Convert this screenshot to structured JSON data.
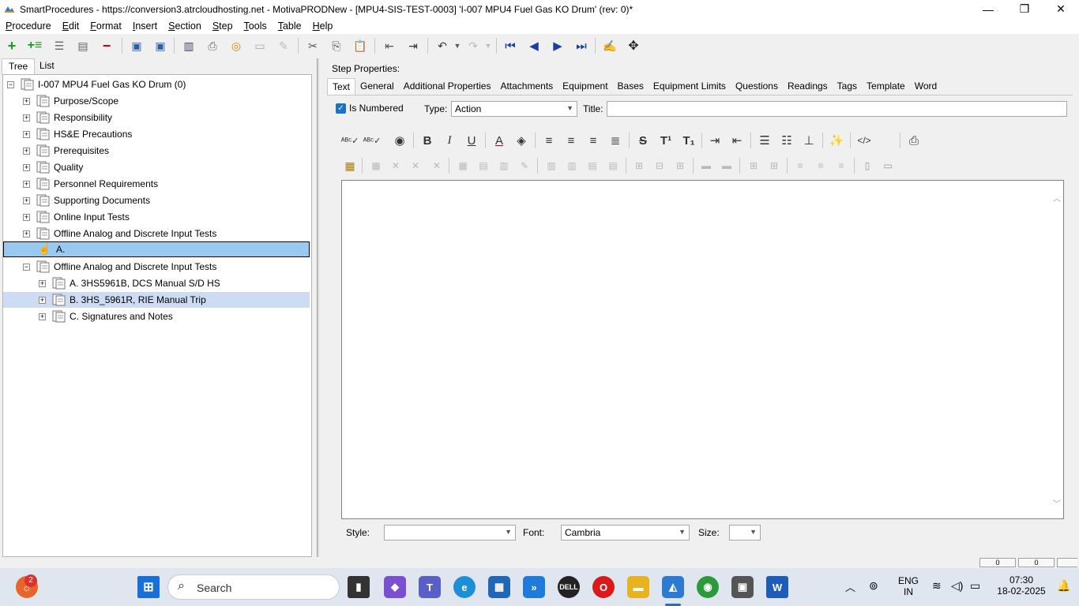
{
  "window": {
    "title": "SmartProcedures - https://conversion3.atrcloudhosting.net - MotivaPRODNew - [MPU4-SIS-TEST-0003] 'I-007 MPU4 Fuel Gas KO Drum' (rev: 0)*",
    "minimize": "—",
    "maximize": "❐",
    "close": "✕"
  },
  "menu": [
    {
      "key": "P",
      "rest": "rocedure"
    },
    {
      "key": "E",
      "rest": "dit"
    },
    {
      "key": "F",
      "rest": "ormat"
    },
    {
      "key": "I",
      "rest": "nsert"
    },
    {
      "key": "S",
      "rest": "ection"
    },
    {
      "key": "S",
      "rest": "tep"
    },
    {
      "key": "T",
      "rest": "ools"
    },
    {
      "key": "T",
      "rest": "able"
    },
    {
      "key": "H",
      "rest": "elp"
    }
  ],
  "left_tabs": {
    "tree": "Tree",
    "list": "List"
  },
  "tree": {
    "root": "I-007 MPU4 Fuel Gas KO Drum (0)",
    "items": [
      "Purpose/Scope",
      "Responsibility",
      "HS&E Precautions",
      "Prerequisites",
      "Quality",
      "Personnel Requirements",
      "Supporting Documents",
      "Online Input Tests",
      "Offline Analog and Discrete Input Tests"
    ],
    "selected_item": "A.",
    "section": "Offline Analog and Discrete Input Tests",
    "children": [
      "A. 3HS5961B, DCS Manual S/D HS",
      "B. 3HS_5961R, RIE Manual Trip",
      "C. Signatures and Notes"
    ]
  },
  "step_properties": {
    "heading": "Step Properties:",
    "tabs": [
      "Text",
      "General",
      "Additional Properties",
      "Attachments",
      "Equipment",
      "Bases",
      "Equipment Limits",
      "Questions",
      "Readings",
      "Tags",
      "Template",
      "Word"
    ],
    "is_numbered_label": "Is Numbered",
    "is_numbered": true,
    "type_label": "Type:",
    "type_value": "Action",
    "title_label": "Title:",
    "title_value": "",
    "style_label": "Style:",
    "style_value": "",
    "font_label": "Font:",
    "font_value": "Cambria",
    "size_label": "Size:",
    "size_value": ""
  },
  "status": {
    "box1": "0",
    "box2": "0"
  },
  "taskbar": {
    "search_label": "Search",
    "weather_badge": "2",
    "language_line1": "ENG",
    "language_line2": "IN",
    "time": "07:30",
    "date": "18-02-2025"
  },
  "colors": {
    "selection": "#99c9ef",
    "highlight": "#cddcf3",
    "accent": "#1a73c8"
  }
}
